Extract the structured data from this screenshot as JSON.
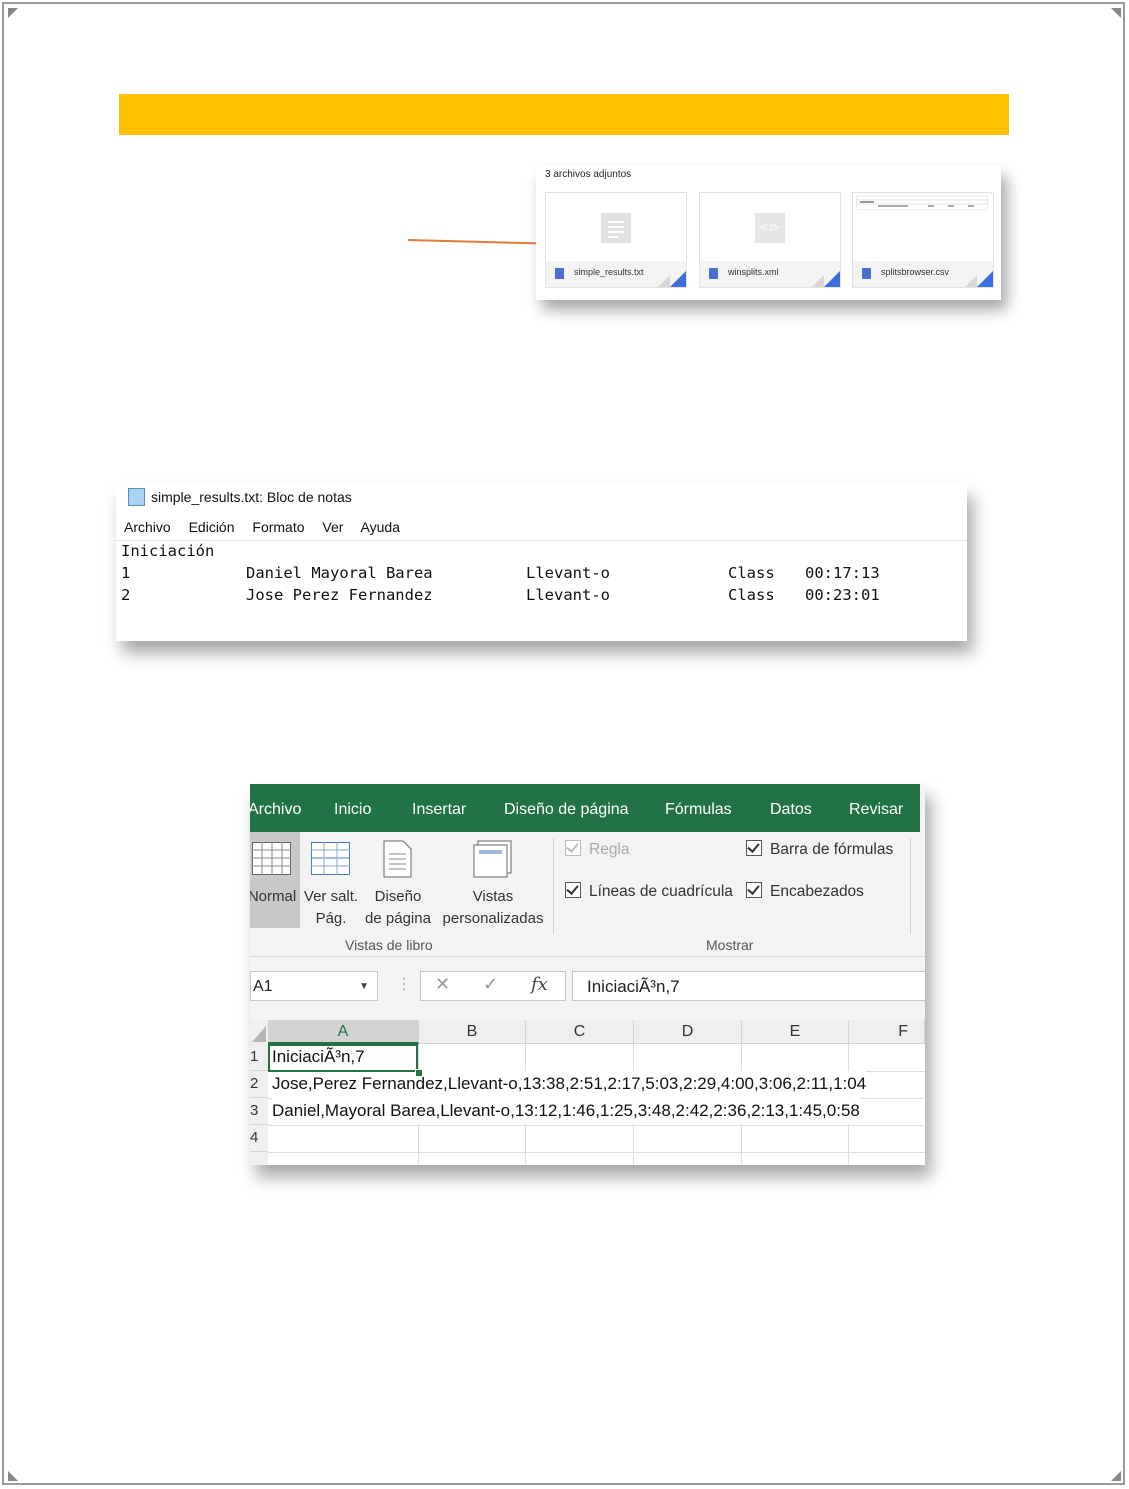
{
  "attachments": {
    "title": "3 archivos adjuntos",
    "files": [
      {
        "name": "simple_results.txt",
        "thumb_icon": "text-lines-icon"
      },
      {
        "name": "winsplits.xml",
        "thumb_icon": "code-icon",
        "thumb_text": "< />"
      },
      {
        "name": "splitsbrowser.csv",
        "thumb_icon": "spreadsheet-preview"
      }
    ],
    "arrow_color": "#e07b39"
  },
  "notepad": {
    "title": "simple_results.txt: Bloc de notas",
    "menu": [
      "Archivo",
      "Edición",
      "Formato",
      "Ver",
      "Ayuda"
    ],
    "heading": "Iniciación",
    "rows": [
      {
        "pos": "1",
        "name": "Daniel Mayoral Barea",
        "club": "Llevant-o",
        "class": "Class",
        "time": "00:17:13"
      },
      {
        "pos": "2",
        "name": "Jose Perez Fernandez",
        "club": "Llevant-o",
        "class": "Class",
        "time": "00:23:01"
      }
    ]
  },
  "excel": {
    "tabs": [
      "Archivo",
      "Inicio",
      "Insertar",
      "Diseño de página",
      "Fórmulas",
      "Datos",
      "Revisar"
    ],
    "ribbon": {
      "views": [
        {
          "line1": "Normal",
          "line2": ""
        },
        {
          "line1": "Ver salt.",
          "line2": "Pág."
        },
        {
          "line1": "Diseño",
          "line2": "de página"
        },
        {
          "line1": "Vistas",
          "line2": "personalizadas"
        }
      ],
      "views_group": "Vistas de libro",
      "show_group": "Mostrar",
      "checkboxes": {
        "ruler": "Regla",
        "formula_bar": "Barra de fórmulas",
        "gridlines": "Líneas de cuadrícula",
        "headings": "Encabezados"
      }
    },
    "name_box": "A1",
    "formula": "IniciaciÃ³n,7",
    "columns": [
      "A",
      "B",
      "C",
      "D",
      "E",
      "F"
    ],
    "rows": [
      {
        "num": "1",
        "value": "IniciaciÃ³n,7"
      },
      {
        "num": "2",
        "value": "Jose,Perez Fernandez,Llevant-o,13:38,2:51,2:17,5:03,2:29,4:00,3:06,2:11,1:04"
      },
      {
        "num": "3",
        "value": "Daniel,Mayoral Barea,Llevant-o,13:12,1:46,1:25,3:48,2:42,2:36,2:13,1:45,0:58"
      },
      {
        "num": "4",
        "value": ""
      }
    ],
    "accent": "#217346"
  },
  "banner_color": "#ffc000"
}
